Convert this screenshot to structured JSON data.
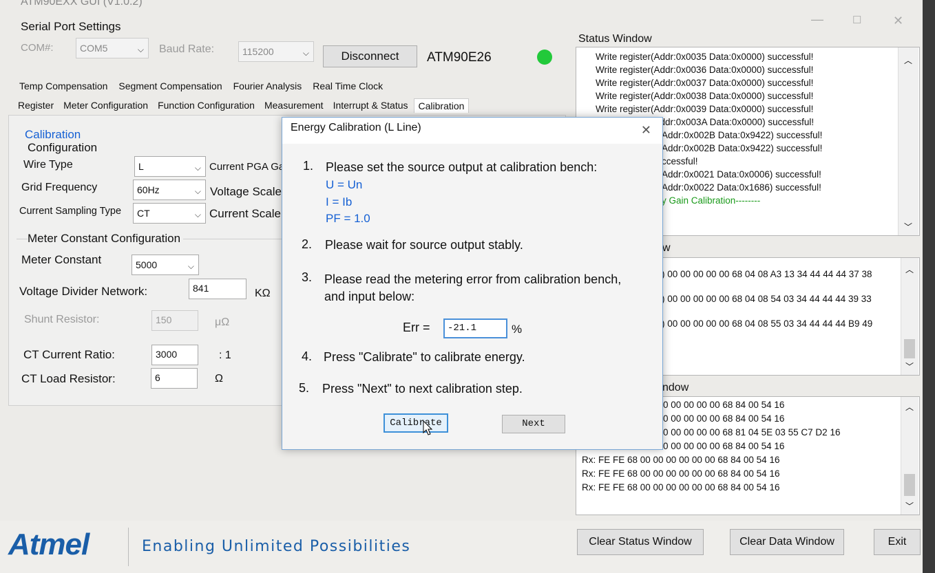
{
  "window": {
    "title": "ATM90EXX GUI (V1.0.2)",
    "minimize": "—",
    "maximize": "☐",
    "close": "✕"
  },
  "serial": {
    "group_label": "Serial Port Settings",
    "com_label": "COM#:",
    "com_value": "COM5",
    "baud_label": "Baud Rate:",
    "baud_value": "115200",
    "disconnect_label": "Disconnect",
    "device_name": "ATM90E26",
    "status_color": "#22c93a"
  },
  "tabs_row1": [
    "Temp Compensation",
    "Segment Compensation",
    "Fourier Analysis",
    "Real Time Clock"
  ],
  "tabs_row2": [
    "Register",
    "Meter Configuration",
    "Function Configuration",
    "Measurement",
    "Interrupt & Status",
    "Calibration"
  ],
  "calibration": {
    "section_title": "Calibration",
    "config_title": "Configuration",
    "wire_type_label": "Wire Type",
    "wire_type_value": "L",
    "grid_freq_label": "Grid Frequency",
    "grid_freq_value": "60Hz",
    "sampling_label": "Current Sampling Type",
    "sampling_value": "CT",
    "current_pga_label": "Current PGA Ga",
    "voltage_scale_label": "Voltage Scale",
    "current_scale_label": "Current Scale",
    "meter_const_group": "Meter Constant Configuration",
    "meter_const_label": "Meter Constant",
    "meter_const_value": "5000",
    "vdn_label": "Voltage Divider Network:",
    "vdn_value": "841",
    "vdn_unit": "KΩ",
    "shunt_label": "Shunt Resistor:",
    "shunt_value": "150",
    "shunt_unit": "μΩ",
    "ct_ratio_label": "CT Current Ratio:",
    "ct_ratio_value": "3000",
    "ct_ratio_unit": ": 1",
    "ct_load_label": "CT Load Resistor:",
    "ct_load_value": "6",
    "ct_load_unit": "Ω"
  },
  "status_window": {
    "label": "Status Window",
    "lines": [
      "Write register(Addr:0x0035  Data:0x0000) successful!",
      "Write register(Addr:0x0036  Data:0x0000) successful!",
      "Write register(Addr:0x0037  Data:0x0000) successful!",
      "Write register(Addr:0x0038  Data:0x0000) successful!",
      "Write register(Addr:0x0039  Data:0x0000) successful!",
      "Write register(Addr:0x003A  Data:0x0000) successful!",
      "Addr:0x002B  Data:0x9422) successful!",
      "Addr:0x002B  Data:0x9422) successful!",
      "ccessful!",
      "Addr:0x0021  Data:0x0006) successful!",
      "Addr:0x0022  Data:0x1686) successful!",
      "y Gain Calibration--------"
    ]
  },
  "tx_window": {
    "label_visible": "w",
    "lines": [
      ") 00 00 00 00 00 68 04 08 A3 13 34 44 44 44 37 38",
      ") 00 00 00 00 00 68 04 08 54 03 34 44 44 44 39 33",
      ") 00 00 00 00 00 68 04 08 55 03 34 44 44 44 B9 49"
    ]
  },
  "rx_window": {
    "label_visible": "ndow",
    "lines": [
      "0 00 00 00 00 68 84 00 54 16",
      "0 00 00 00 00 68 84 00 54 16",
      "0 00 00 00 00 68 81 04 5E 03 55 C7 D2 16",
      "0 00 00 00 00 68 84 00 54 16",
      "Rx: FE FE 68 00 00 00 00 00 00 68 84 00 54 16",
      "Rx: FE FE 68 00 00 00 00 00 00 68 84 00 54 16",
      "Rx: FE FE 68 00 00 00 00 00 00 68 84 00 54 16"
    ]
  },
  "dialog": {
    "title": "Energy Calibration (L Line)",
    "close": "✕",
    "step1_num": "1.",
    "step1": "Please set the source output at calibration bench:",
    "u": "U = Un",
    "i": "I = Ib",
    "pf": "PF = 1.0",
    "step2_num": "2.",
    "step2": "Please wait for source output stably.",
    "step3_num": "3.",
    "step3a": "Please read the metering error from calibration bench,",
    "step3b": "and input below:",
    "err_label": "Err =",
    "err_value": "-21.1",
    "err_unit": "%",
    "step4_num": "4.",
    "step4": "Press \"Calibrate\" to calibrate energy.",
    "step5_num": "5.",
    "step5": "Press \"Next\" to next calibration step.",
    "calibrate_btn": "Calibrate",
    "next_btn": "Next"
  },
  "footer": {
    "logo": "Atmel",
    "tagline": "Enabling Unlimited Possibilities",
    "clear_status": "Clear Status Window",
    "clear_data": "Clear Data Window",
    "exit": "Exit"
  }
}
